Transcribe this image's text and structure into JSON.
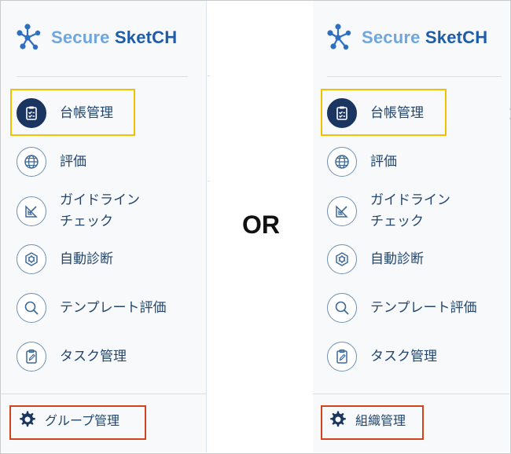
{
  "brand": {
    "word1": "Secure",
    "word2": "SketCH",
    "icon": "network-nodes-icon",
    "colors": {
      "word1": "#6fa7dc",
      "word2": "#1f5ca8",
      "node": "#2f6fc2"
    }
  },
  "nav_items": [
    {
      "label_lines": [
        "台帳管理"
      ],
      "icon": "clipboard-check-icon",
      "active": true
    },
    {
      "label_lines": [
        "評価"
      ],
      "icon": "globe-icon",
      "active": false
    },
    {
      "label_lines": [
        "ガイドライン",
        "チェック"
      ],
      "icon": "drafting-tools-icon",
      "active": false
    },
    {
      "label_lines": [
        "自動診断"
      ],
      "icon": "hexagon-gear-icon",
      "active": false
    },
    {
      "label_lines": [
        "テンプレート評価"
      ],
      "icon": "magnifier-icon",
      "active": false
    },
    {
      "label_lines": [
        "タスク管理"
      ],
      "icon": "clipboard-pen-icon",
      "active": false
    }
  ],
  "left_panel": {
    "bottom_label": "グループ管理",
    "bottom_icon": "gear-icon"
  },
  "right_panel": {
    "bottom_label": "組織管理",
    "bottom_icon": "gear-icon"
  },
  "separator_text": "OR",
  "highlight_colors": {
    "item": "#f3c000",
    "bottom": "#d2421d"
  }
}
